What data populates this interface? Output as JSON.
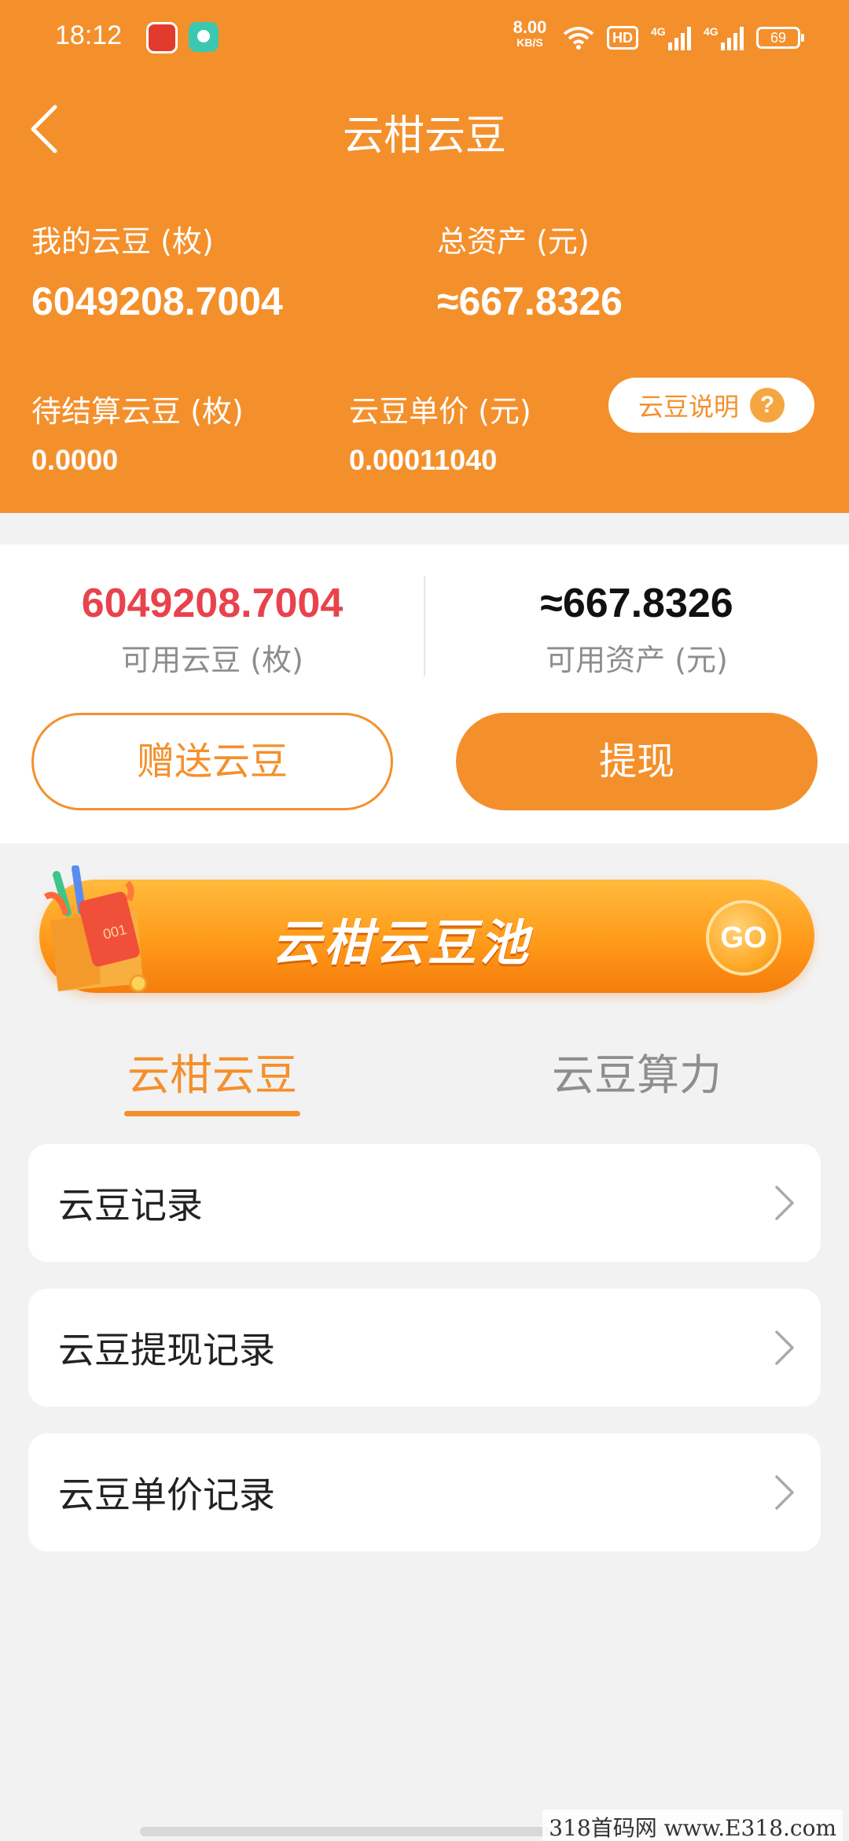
{
  "status_bar": {
    "time": "18:12",
    "net_speed": "8.00",
    "net_unit": "KB/S",
    "hd": "HD",
    "signal1": "4G",
    "signal2": "4G",
    "battery": "69"
  },
  "header": {
    "title": "云柑云豆",
    "my_beans_label": "我的云豆 (枚)",
    "my_beans_value": "6049208.7004",
    "total_assets_label": "总资产 (元)",
    "total_assets_value": "≈667.8326",
    "pending_label": "待结算云豆 (枚)",
    "pending_value": "0.0000",
    "unit_price_label": "云豆单价 (元)",
    "unit_price_value": "0.00011040",
    "explain_button": "云豆说明",
    "help_glyph": "?"
  },
  "available": {
    "beans_value": "6049208.7004",
    "beans_label": "可用云豆 (枚)",
    "assets_value": "≈667.8326",
    "assets_label": "可用资产 (元)",
    "gift_button": "赠送云豆",
    "withdraw_button": "提现"
  },
  "banner": {
    "text": "云柑云豆池",
    "go": "GO",
    "card_text": "001"
  },
  "tabs": [
    {
      "label": "云柑云豆",
      "active": true
    },
    {
      "label": "云豆算力",
      "active": false
    }
  ],
  "list": [
    {
      "label": "云豆记录"
    },
    {
      "label": "云豆提现记录"
    },
    {
      "label": "云豆单价记录"
    }
  ],
  "watermark": "318首码网 www.E318.com",
  "colors": {
    "primary": "#f4902c",
    "red_value": "#e8434d",
    "background": "#f2f2f2"
  }
}
